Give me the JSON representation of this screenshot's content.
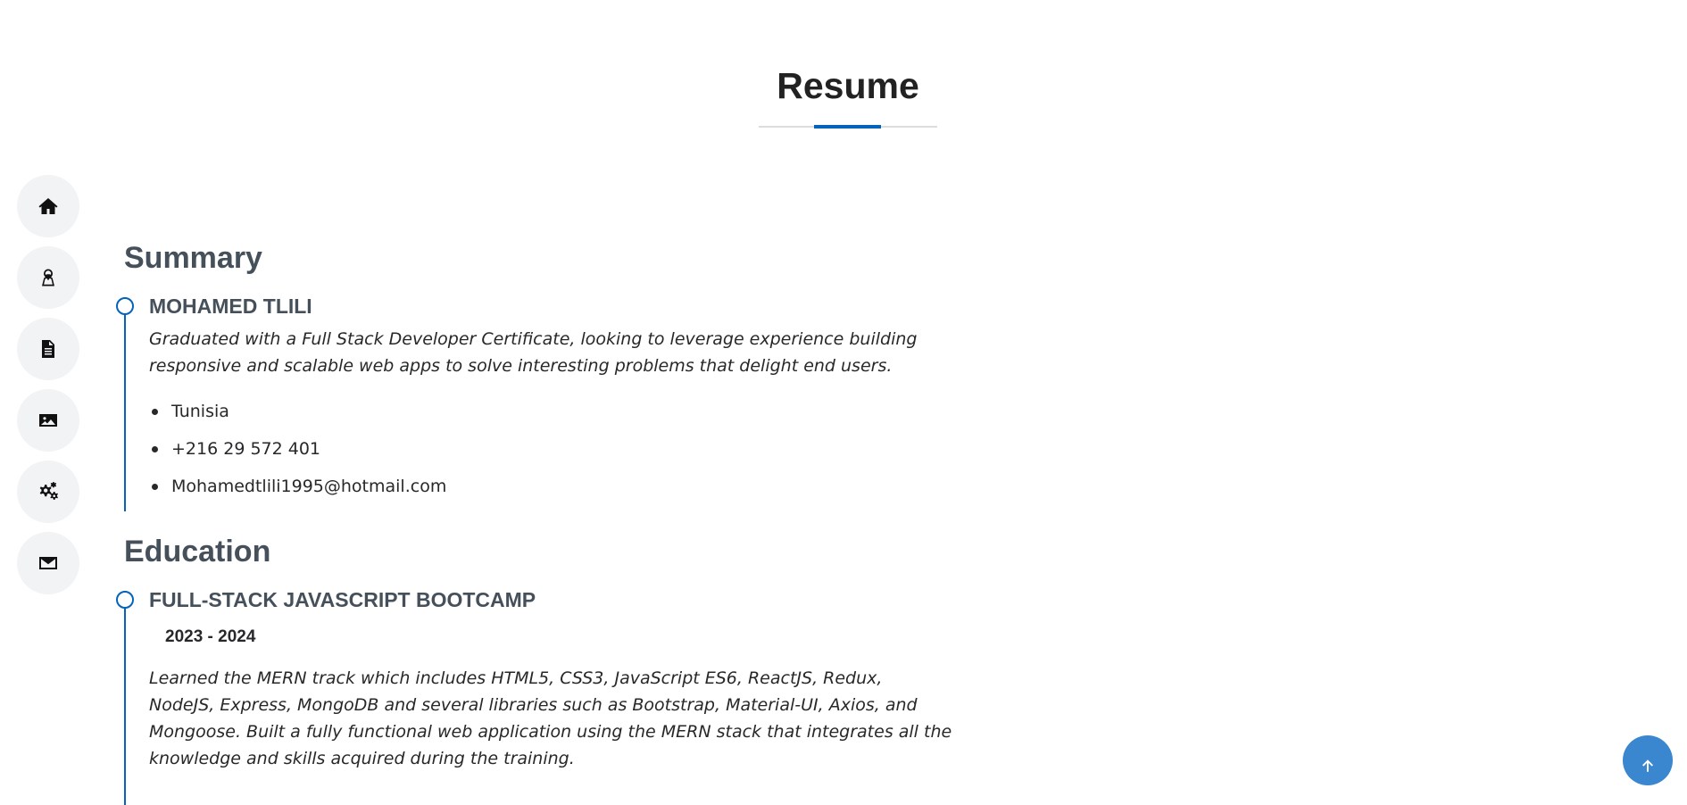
{
  "section": {
    "title": "Resume"
  },
  "nav": {
    "items": [
      {
        "icon": "home-icon",
        "label": "Home"
      },
      {
        "icon": "user-icon",
        "label": "About"
      },
      {
        "icon": "document-icon",
        "label": "Resume"
      },
      {
        "icon": "image-icon",
        "label": "Portfolio"
      },
      {
        "icon": "gears-icon",
        "label": "Services"
      },
      {
        "icon": "envelope-icon",
        "label": "Contact"
      }
    ]
  },
  "summary": {
    "heading": "Summary",
    "name": "MOHAMED TLILI",
    "description": "Graduated with a Full Stack Developer Certificate, looking to leverage experience building responsive and scalable web apps to solve interesting problems that delight end users.",
    "contacts": [
      "Tunisia",
      "+216 29 572 401",
      "Mohamedtlili1995@hotmail.com"
    ]
  },
  "education": {
    "heading": "Education",
    "items": [
      {
        "title": "FULL-STACK JAVASCRIPT BOOTCAMP",
        "dates": "2023 - 2024",
        "description": "Learned the MERN track which includes HTML5, CSS3, JavaScript ES6, ReactJS, Redux, NodeJS, Express, MongoDB and several libraries such as Bootstrap, Material-UI, Axios, and Mongoose. Built a fully functional web application using the MERN stack that integrates all the knowledge and skills acquired during the training."
      }
    ]
  },
  "colors": {
    "accent": "#0563bb",
    "heading": "#45505b",
    "nav_bg": "#f2f3f5",
    "back_to_top": "#3a86cf"
  }
}
